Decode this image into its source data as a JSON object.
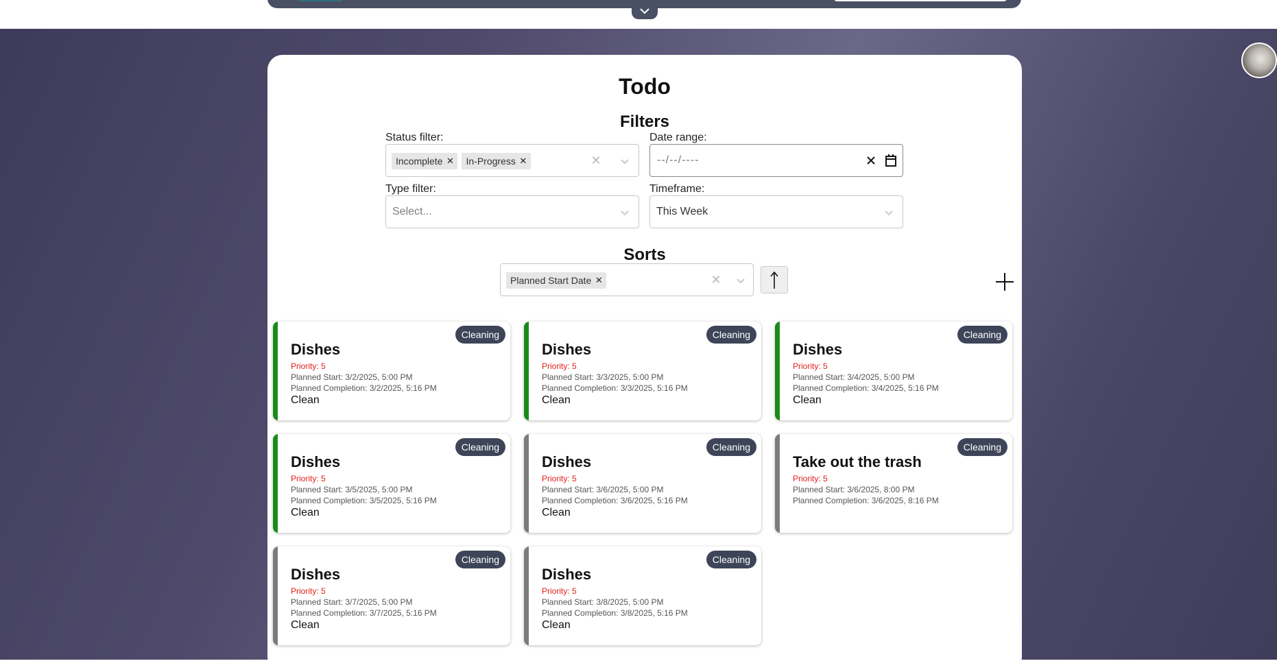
{
  "page": {
    "title": "Todo",
    "filters_heading": "Filters",
    "sorts_heading": "Sorts"
  },
  "filters": {
    "status": {
      "label": "Status filter:",
      "chips": [
        "Incomplete",
        "In-Progress"
      ]
    },
    "date_range": {
      "label": "Date range:",
      "value": "--/--/----"
    },
    "type": {
      "label": "Type filter:",
      "placeholder": "Select..."
    },
    "timeframe": {
      "label": "Timeframe:",
      "value": "This Week"
    }
  },
  "sorts": {
    "chips": [
      "Planned Start Date"
    ],
    "direction": "ascending"
  },
  "icons": {
    "nav_toggle": "chevron-down-icon",
    "clear": "clear-icon",
    "chevron": "chevron-down-icon",
    "calendar": "calendar-icon",
    "sort_direction": "arrow-up-icon",
    "add": "plus-icon"
  },
  "colors": {
    "complete_bar": "#1a8a1a",
    "pending_bar": "#7b7b7b",
    "badge_bg": "#3e4558",
    "priority_text": "#e0201a"
  },
  "cards": [
    {
      "title": "Dishes",
      "badge": "Cleaning",
      "priority": "Priority: 5",
      "planned_start": "Planned Start: 3/2/2025, 5:00 PM",
      "planned_completion": "Planned Completion: 3/2/2025, 5:16 PM",
      "type": "Clean",
      "bar_color": "#1a8a1a"
    },
    {
      "title": "Dishes",
      "badge": "Cleaning",
      "priority": "Priority: 5",
      "planned_start": "Planned Start: 3/3/2025, 5:00 PM",
      "planned_completion": "Planned Completion: 3/3/2025, 5:16 PM",
      "type": "Clean",
      "bar_color": "#1a8a1a"
    },
    {
      "title": "Dishes",
      "badge": "Cleaning",
      "priority": "Priority: 5",
      "planned_start": "Planned Start: 3/4/2025, 5:00 PM",
      "planned_completion": "Planned Completion: 3/4/2025, 5:16 PM",
      "type": "Clean",
      "bar_color": "#1a8a1a"
    },
    {
      "title": "Dishes",
      "badge": "Cleaning",
      "priority": "Priority: 5",
      "planned_start": "Planned Start: 3/5/2025, 5:00 PM",
      "planned_completion": "Planned Completion: 3/5/2025, 5:16 PM",
      "type": "Clean",
      "bar_color": "#1a8a1a"
    },
    {
      "title": "Dishes",
      "badge": "Cleaning",
      "priority": "Priority: 5",
      "planned_start": "Planned Start: 3/6/2025, 5:00 PM",
      "planned_completion": "Planned Completion: 3/6/2025, 5:16 PM",
      "type": "Clean",
      "bar_color": "#7b7b7b"
    },
    {
      "title": "Take out the trash",
      "badge": "Cleaning",
      "priority": "Priority: 5",
      "planned_start": "Planned Start: 3/6/2025, 8:00 PM",
      "planned_completion": "Planned Completion: 3/6/2025, 8:16 PM",
      "type": "",
      "bar_color": "#7b7b7b"
    },
    {
      "title": "Dishes",
      "badge": "Cleaning",
      "priority": "Priority: 5",
      "planned_start": "Planned Start: 3/7/2025, 5:00 PM",
      "planned_completion": "Planned Completion: 3/7/2025, 5:16 PM",
      "type": "Clean",
      "bar_color": "#7b7b7b"
    },
    {
      "title": "Dishes",
      "badge": "Cleaning",
      "priority": "Priority: 5",
      "planned_start": "Planned Start: 3/8/2025, 5:00 PM",
      "planned_completion": "Planned Completion: 3/8/2025, 5:16 PM",
      "type": "Clean",
      "bar_color": "#7b7b7b"
    }
  ]
}
